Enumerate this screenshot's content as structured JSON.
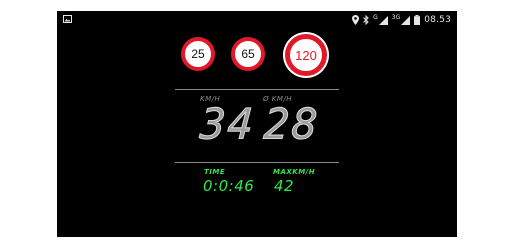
{
  "statusbar": {
    "left_icon": "image-icon",
    "network_label": "G",
    "network_label_2": "3G",
    "time": "08.53"
  },
  "speed_signs": [
    {
      "label": "25"
    },
    {
      "label": "65"
    },
    {
      "label": "120"
    }
  ],
  "speed_panel": {
    "current_label": "KM/H",
    "average_label": "Ø KM/H",
    "current_value": "34",
    "average_value": "28"
  },
  "stats": {
    "time_label": "TIME",
    "time_value": "0:0:46",
    "max_label": "MAXKM/H",
    "max_value": "42"
  },
  "colors": {
    "background": "#000000",
    "sign_border": "#e0192a",
    "accent_green": "#2ee84a",
    "lcd_gray": "#c4c4c4"
  }
}
